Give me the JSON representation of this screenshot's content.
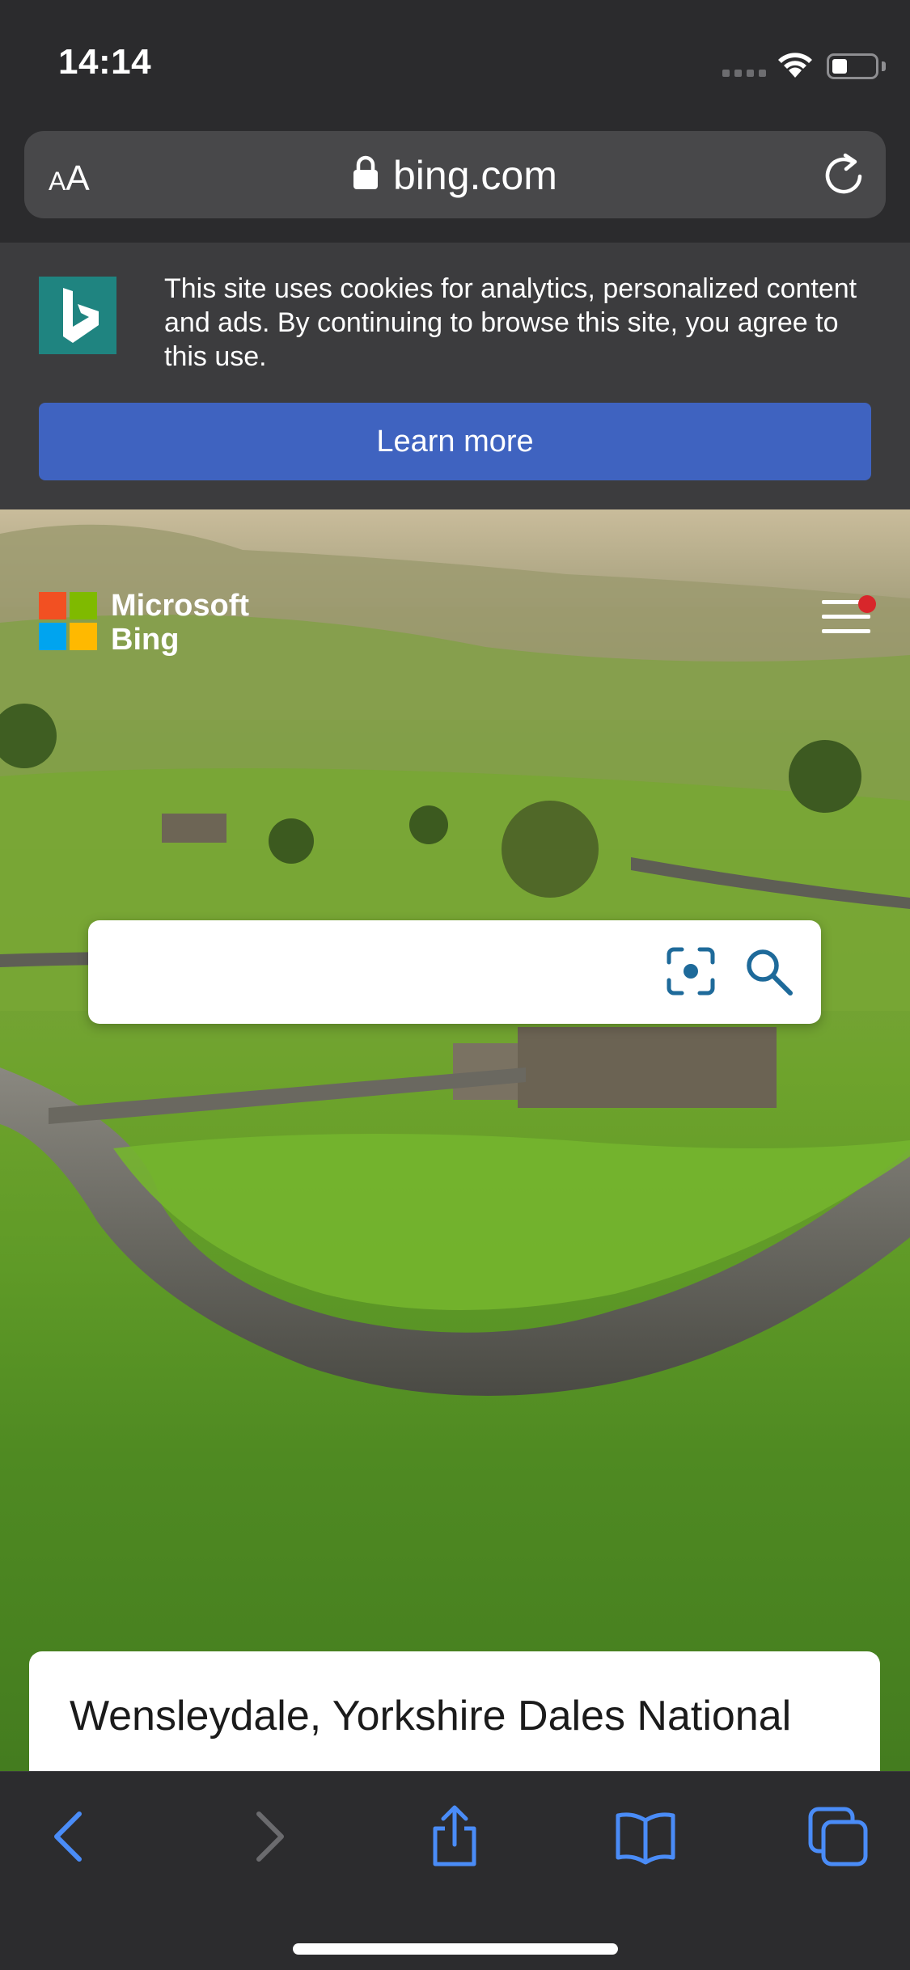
{
  "status_bar": {
    "time": "14:14"
  },
  "address_bar": {
    "text_size_label": "AA",
    "url": "bing.com"
  },
  "cookie_banner": {
    "message": "This site uses cookies for analytics, personalized content and ads. By continuing to browse this site, you agree to this use.",
    "learn_more_label": "Learn more"
  },
  "header": {
    "brand_line1": "Microsoft",
    "brand_line2": "Bing",
    "menu_has_notification": true
  },
  "search": {
    "value": "",
    "placeholder": ""
  },
  "image_caption": {
    "text": "Wensleydale, Yorkshire Dales National"
  },
  "toolbar": {
    "icons": [
      "back-icon",
      "forward-icon",
      "share-icon",
      "bookmarks-icon",
      "tabs-icon"
    ]
  },
  "colors": {
    "accent": "#3f63c0",
    "bing_teal": "#1f8480",
    "notification": "#d8262b",
    "icon_blue": "#4a8cf7"
  }
}
